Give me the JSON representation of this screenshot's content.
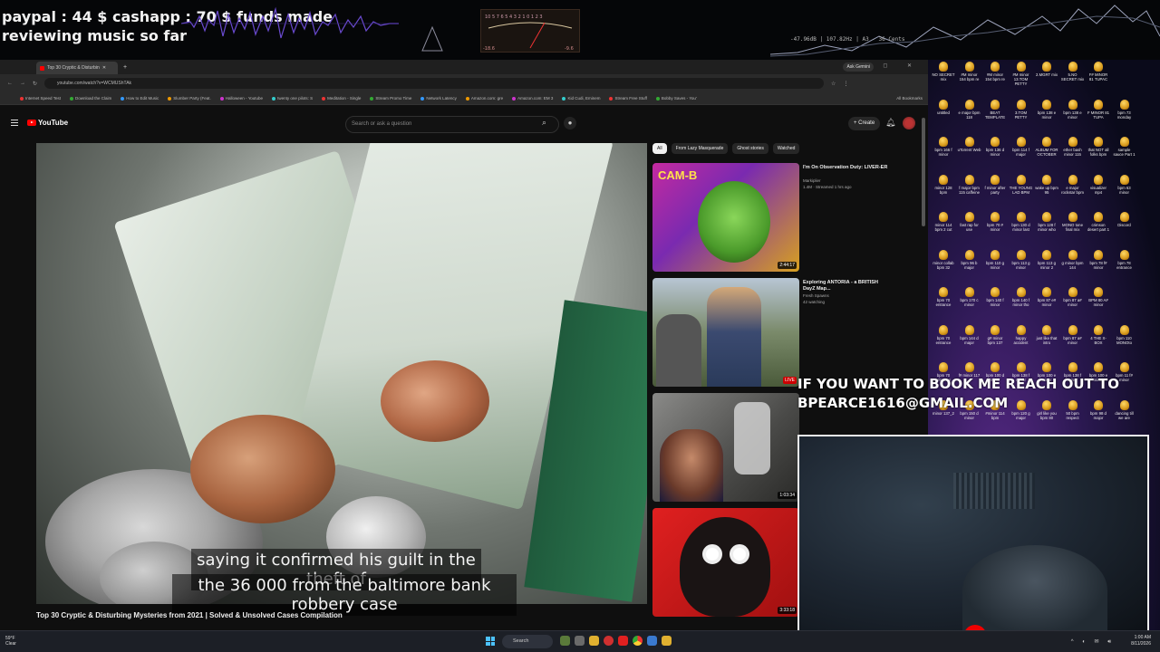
{
  "overlay": {
    "funds_line1": "paypal : 44 $  cashapp : 70 $ funds made",
    "funds_line2": "reviewing music so far",
    "booking_line1": "IF YOU WANT TO BOOK ME REACH OUT TO",
    "booking_line2": "BPEARCE1616@GMAIL.COM",
    "spectrum_readout": "-47.96dB | 107.82Hz | A3 - 36 Cents"
  },
  "browser": {
    "tab_title": "Top 30 Cryptic & Disturbin",
    "ask_gemini": "Ask Gemini",
    "window_controls": "– ◻ ✕",
    "url": "youtube.com/watch?v=WCMUShTAk",
    "bookmarks": [
      "Internet Speed Test",
      "Download the Claim",
      "How to Edit Music",
      "Slumber Party (Feat.",
      "Halloween - Youtube",
      "twenty one pilots: S",
      "Meditation - Single",
      "Stream Promo Time",
      "Network Latency",
      "Amazon.com: gre",
      "Amazon.com: EM 3",
      "Kid Cudi, Eminem",
      "Stream Free Stuff",
      "Bobby Saves - You'"
    ],
    "all_bookmarks": "All Bookmarks"
  },
  "youtube": {
    "logo_text": "YouTube",
    "search_placeholder": "Search or ask a question",
    "create_label": "Create",
    "video_title": "Top 30 Cryptic & Disturbing Mysteries from 2021 | Solved & Unsolved Cases Compilation",
    "caption_line1": "saying it confirmed his guilt in the theft of",
    "caption_line2": "the 36 000 from the baltimore bank robbery case",
    "chips": [
      "All",
      "From Lazy Masquerade",
      "Ghost stories",
      "Watched"
    ],
    "recommendations": [
      {
        "title": "I'm On Observation Duty: LIVER-ER",
        "channel": "Markiplier",
        "meta": "1.4M · Streamed 1 hrs ago",
        "duration": "2:44:17",
        "thumb_label": "CAM-B"
      },
      {
        "title": "Exploring ANTORIA - a BRITISH DayZ Map...",
        "channel": "Fresh Spawns",
        "meta": "42 watching",
        "duration": "LIVE"
      },
      {
        "title": "",
        "channel": "",
        "meta": "",
        "duration": "1:03:34"
      },
      {
        "title": "",
        "channel": "",
        "meta": "",
        "duration": "3:33:18"
      }
    ]
  },
  "desktop_icons": [
    [
      "NO SECRET mix",
      "#M minor 154 bpm re",
      "#M minor 154 bpm re",
      "#M minor 13.TOM PETTY",
      "2.MGRT mix",
      "5.NO SECRET mix",
      "F# MINOR 81 TUPAC"
    ],
    [
      "untitled",
      "e major bpm 118",
      "BEAT TEMPLATE",
      "3.TOM PETTY",
      "bpm 138 e minor",
      "bpm 138 e minor",
      "F MINOR 81 TUPA",
      "bpm 73 monday"
    ],
    [
      "bpm 166 f minor",
      "uTorrent Web",
      "bpm 136 d minor",
      "bpm 114 f major",
      "ALBUM FOR OCTOBER",
      "ether bash minor 115",
      "that NOT all folks bpm",
      "sample sauce Part 1"
    ],
    [
      "minor 128 bpm",
      "f major bpm 115 caffeine",
      "f minor after party",
      "THE YOUNG LAD BPM",
      "wake up bpm 95",
      "e major rockstar bpm",
      "visualizer mp4",
      "bpm 63 minor"
    ],
    [
      "minor 114 bpm 2 cut",
      "fast rap for use",
      "bpm 70 # minor",
      "bpm 130 d minor last",
      "bpm 128 f minor who",
      "MONO tone final mix",
      "crimson desert part 1",
      "Discord"
    ],
    [
      "minor collab bpm 32",
      "bpm 96 b major",
      "bpm 110 g minor",
      "bpm 113 g minor",
      "bpm 113 g minor 2",
      "g minor bpm 144",
      "bpm 78 f# minor",
      "bpm 78 entrance"
    ],
    [
      "bpm 70 entrance",
      "bpm 170 c minor",
      "bpm 140 f minor",
      "bpm 140 f minor tho",
      "bpm 87 e# minor",
      "bpm 87 a# minor",
      "BPM 80 A# minor"
    ],
    [
      "bpm 70 entrance",
      "bpm 144 d major",
      "g# minor bpm 137",
      "happy accident",
      "just like that intro",
      "bpm 87 a# minor",
      "4 THE X-BOX",
      "bpm 110 MONOto"
    ],
    [
      "bpm 70 entrance",
      "f# minor 117",
      "bpm 100 d minor",
      "bpm 138 f minor",
      "bpm 100 e minor",
      "bpm 138 f minor",
      "bpm 100 e minor",
      "bpm 11 f# minor"
    ],
    [
      "minor 137_2",
      "bpm 150 d minor",
      "#minor 114 bpm",
      "bpm 120 g major",
      "girl like you bpm 80",
      "50 bpm respect",
      "bpm 98 d major",
      "dancing till we are"
    ]
  ],
  "taskbar": {
    "weather_temp": "59°F",
    "weather_desc": "Clear",
    "search_label": "Search",
    "time": "1:00 AM",
    "date": "8/11/2026"
  }
}
